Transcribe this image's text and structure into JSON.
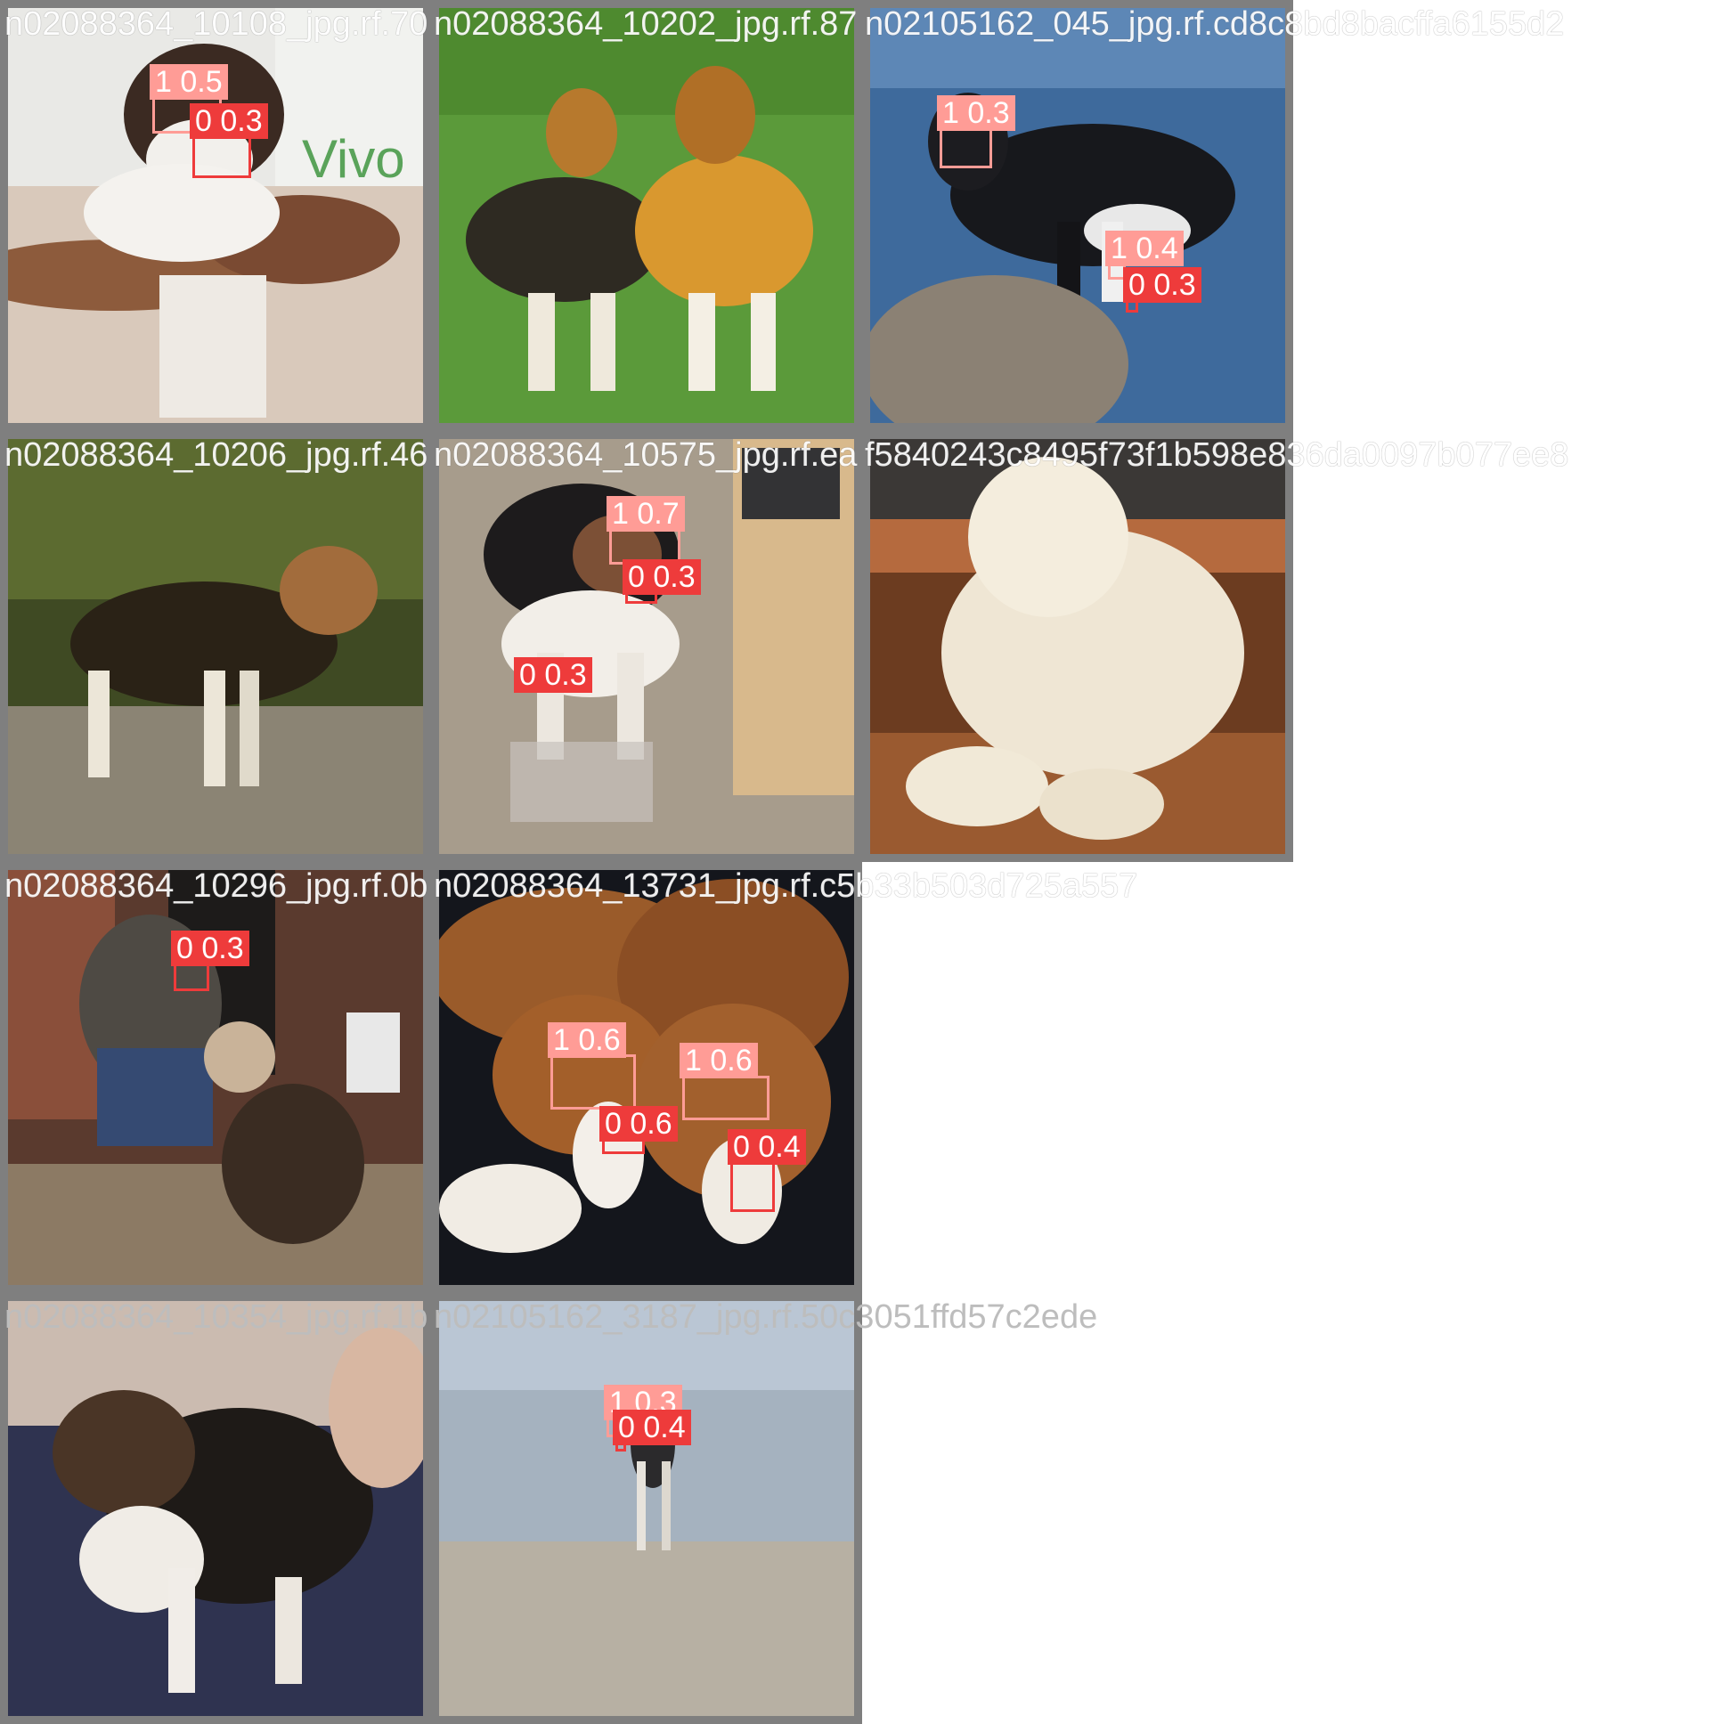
{
  "colors": {
    "class1": "#ff9c96",
    "class0": "#ee3b3b",
    "tile_border": "#7f7f7f"
  },
  "captions": [
    "n02088364_10108_jpg.rf.70",
    "n02088364_10202_jpg.rf.87",
    "n02105162_045_jpg.rf.cd8c8bd8bacffa6155d2",
    "n02088364_10206_jpg.rf.46",
    "n02088364_10575_jpg.rf.ea",
    "f5840243c8495f73f1b598e836da0097b077ee8",
    "n02088364_10296_jpg.rf.0b",
    "n02088364_13731_jpg.rf.c5b33b503d725a557",
    "n02088364_10354_jpg.rf.1b",
    "n02105162_3187_jpg.rf.50c3051ffd57c2ede"
  ],
  "labels": {
    "t1_a": "1 0.5",
    "t1_b": "0 0.3",
    "t3_a": "1 0.3",
    "t3_b": "1 0.4",
    "t3_c": "0 0.3",
    "t5_a": "1 0.7",
    "t5_b": "0 0.3",
    "t5_c": "0 0.3",
    "t7_a": "0 0.3",
    "t8_a": "1 0.6",
    "t8_b": "1 0.6",
    "t8_c": "0 0.6",
    "t8_d": "0 0.4",
    "t10_a": "1 0.3",
    "t10_b": "0 0.4"
  },
  "brand_text": "Vivo"
}
